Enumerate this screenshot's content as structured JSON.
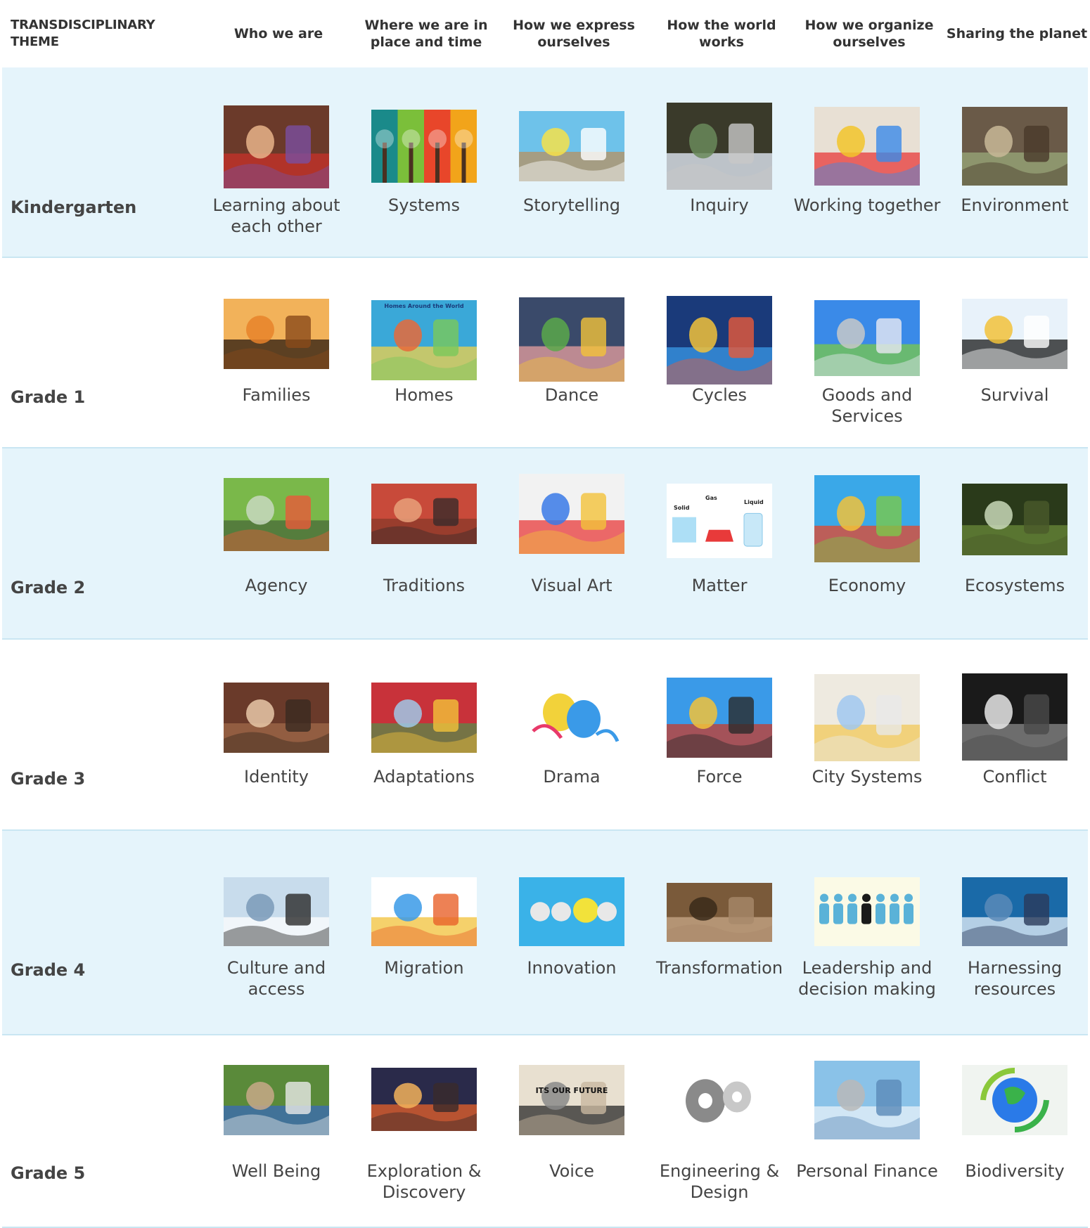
{
  "header": {
    "first": "TRANSDISCIPLINARY THEME",
    "themes": [
      "Who we are",
      "Where we are in place and time",
      "How we express ourselves",
      "How the world works",
      "How we organize ourselves",
      "Sharing the planet"
    ]
  },
  "rows": [
    {
      "grade": "Kindergarten",
      "items": [
        {
          "label": "Learning about each other",
          "icon": "girl-with-leaf-photo"
        },
        {
          "label": "Systems",
          "icon": "four-seasons-trees-image"
        },
        {
          "label": "Storytelling",
          "icon": "child-paper-plane-photo"
        },
        {
          "label": "Inquiry",
          "icon": "waterfall-explorer-photo"
        },
        {
          "label": "Working together",
          "icon": "children-painting-photo"
        },
        {
          "label": "Environment",
          "icon": "squirrel-in-tree-photo"
        }
      ]
    },
    {
      "grade": "Grade 1",
      "items": [
        {
          "label": "Families",
          "icon": "family-silhouette-sunset-photo"
        },
        {
          "label": "Homes",
          "icon": "homes-world-map-image",
          "text": "Homes Around the World"
        },
        {
          "label": "Dance",
          "icon": "hula-dancers-photo"
        },
        {
          "label": "Cycles",
          "icon": "cycles-wheel-diagram"
        },
        {
          "label": "Goods and Services",
          "icon": "city-isometric-illustration"
        },
        {
          "label": "Survival",
          "icon": "penguins-in-snow-photo"
        }
      ]
    },
    {
      "grade": "Grade 2",
      "items": [
        {
          "label": "Agency",
          "icon": "children-in-forest-photo"
        },
        {
          "label": "Traditions",
          "icon": "henna-hands-photo"
        },
        {
          "label": "Visual Art",
          "icon": "paint-palette-brushes-photo"
        },
        {
          "label": "Matter",
          "icon": "states-of-matter-image",
          "texts": [
            "Solid",
            "Gas",
            "Liquid"
          ]
        },
        {
          "label": "Economy",
          "icon": "economy-doodle-illustration"
        },
        {
          "label": "Ecosystems",
          "icon": "forest-waterfall-photo"
        }
      ]
    },
    {
      "grade": "Grade 3",
      "items": [
        {
          "label": "Identity",
          "icon": "smiling-children-photo"
        },
        {
          "label": "Adaptations",
          "icon": "andean-children-photo"
        },
        {
          "label": "Drama",
          "icon": "theatre-masks-illustration"
        },
        {
          "label": "Force",
          "icon": "roller-coaster-photo"
        },
        {
          "label": "City Systems",
          "icon": "city-street-map-image"
        },
        {
          "label": "Conflict",
          "icon": "bus-black-white-photo"
        }
      ]
    },
    {
      "grade": "Grade 4",
      "items": [
        {
          "label": "Culture and access",
          "icon": "ladder-to-clouds-photo"
        },
        {
          "label": "Migration",
          "icon": "globe-of-people-illustration"
        },
        {
          "label": "Innovation",
          "icon": "light-bulb-idea-image"
        },
        {
          "label": "Transformation",
          "icon": "eroded-cliff-photo"
        },
        {
          "label": "Leadership and decision making",
          "icon": "leader-figures-icon"
        },
        {
          "label": "Harnessing resources",
          "icon": "wind-turbine-solar-photo"
        }
      ]
    },
    {
      "grade": "Grade 5",
      "items": [
        {
          "label": "Well Being",
          "icon": "tug-of-war-photo"
        },
        {
          "label": "Exploration & Discovery",
          "icon": "astronaut-alien-planet-image"
        },
        {
          "label": "Voice",
          "icon": "protest-signs-photo",
          "text": "ITS OUR FUTURE"
        },
        {
          "label": "Engineering & Design",
          "icon": "gears-blueprint-image"
        },
        {
          "label": "Personal Finance",
          "icon": "coins-skyline-image"
        },
        {
          "label": "Biodiversity",
          "icon": "recycle-earth-icon"
        }
      ]
    }
  ]
}
